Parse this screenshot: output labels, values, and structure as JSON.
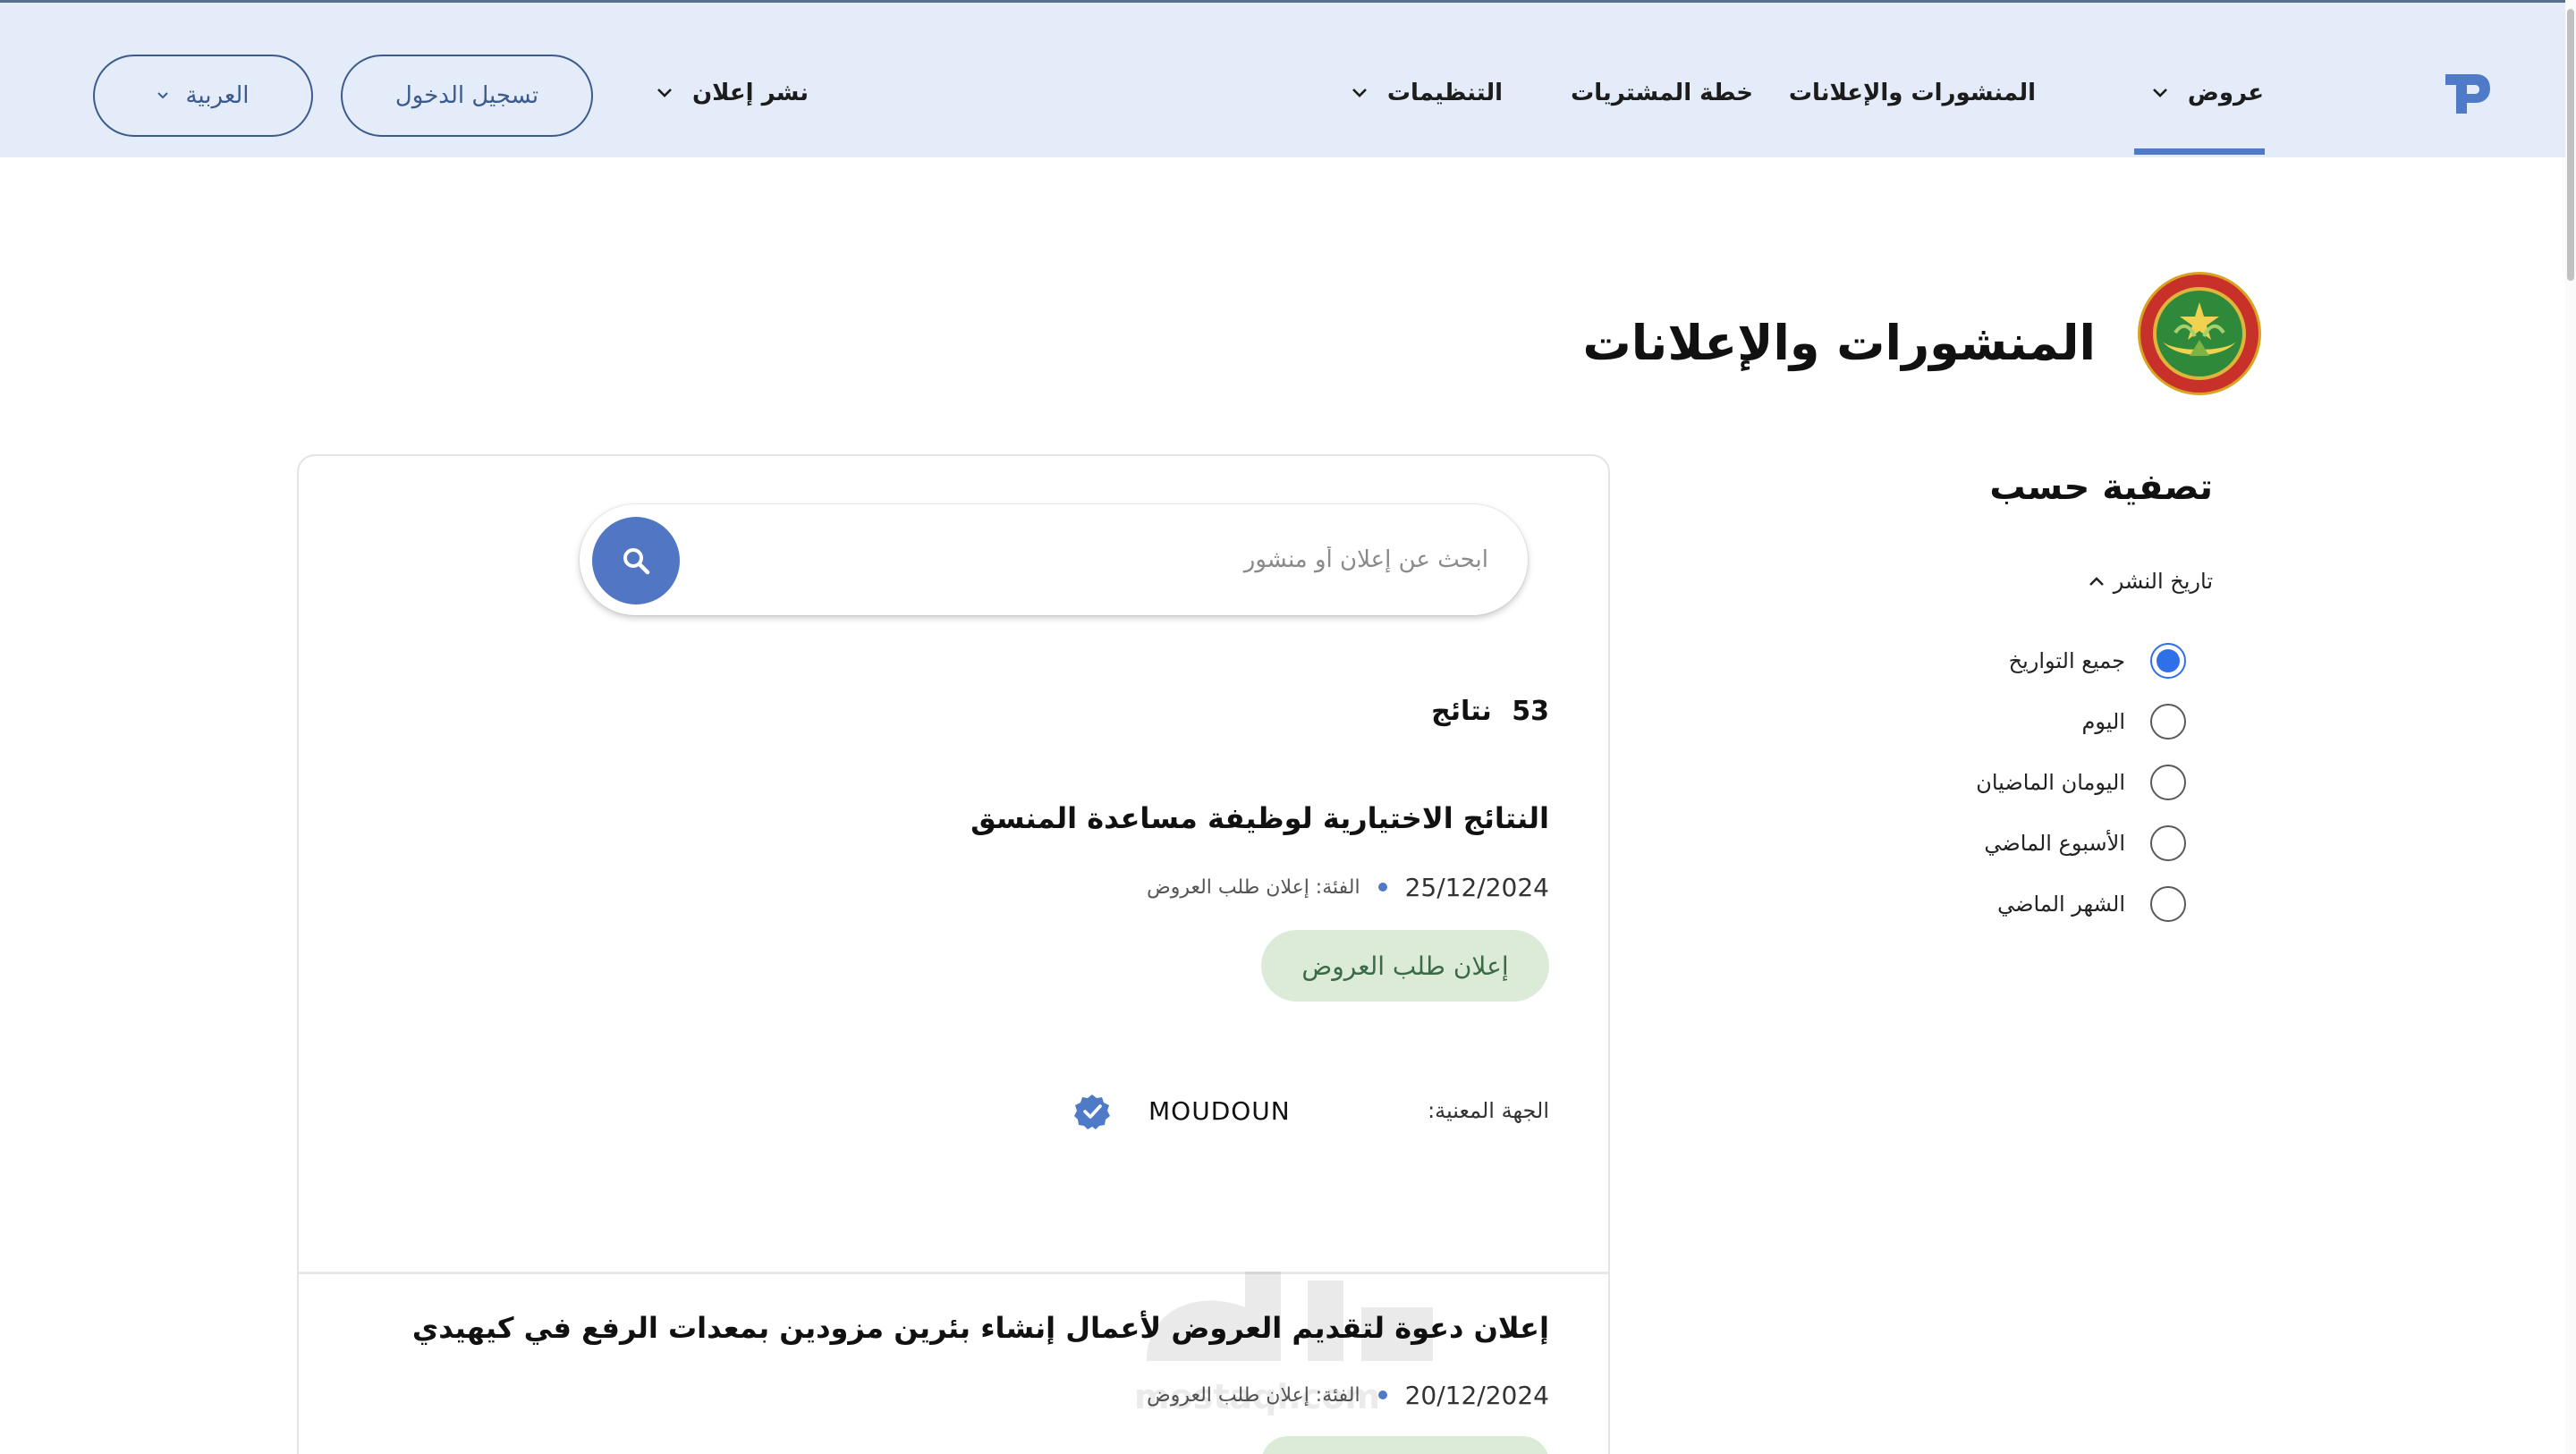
{
  "header": {
    "nav": {
      "offers": "عروض",
      "publications": "المنشورات والإعلانات",
      "procurement_plan": "خطة المشتريات",
      "regulations": "التنظيمات",
      "post_ad": "نشر إعلان"
    },
    "login_label": "تسجيل الدخول",
    "language_label": "العربية",
    "active_nav": "offers",
    "accent_color": "#4f7ac7",
    "header_bg": "#e3ecf8"
  },
  "page": {
    "title": "المنشورات والإعلانات"
  },
  "filters": {
    "title": "تصفية حسب",
    "group_label": "تاريخ النشر",
    "options": [
      {
        "label": "جميع التواريخ",
        "checked": true
      },
      {
        "label": "اليوم",
        "checked": false
      },
      {
        "label": "اليومان الماضيان",
        "checked": false
      },
      {
        "label": "الأسبوع الماضي",
        "checked": false
      },
      {
        "label": "الشهر الماضي",
        "checked": false
      }
    ]
  },
  "search": {
    "placeholder": "ابحث عن إعلان أو منشور",
    "value": ""
  },
  "results": {
    "count": "53",
    "count_label": "نتائج",
    "items": [
      {
        "title": "النتائج الاختيارية لوظيفة مساعدة المنسق",
        "date": "25/12/2024",
        "category": "الفئة: إعلان طلب العروض",
        "tag": "إعلان طلب العروض",
        "entity_label": "الجهة المعنية:",
        "entity_name": "MOUDOUN"
      },
      {
        "title": "إعلان دعوة لتقديم العروض لأعمال إنشاء بئرين مزودين بمعدات الرفع في كيهيدي",
        "date": "20/12/2024",
        "category": "الفئة: إعلان طلب العروض"
      }
    ]
  },
  "watermark": {
    "text": "mostaql.com"
  },
  "colors": {
    "search_button": "#5177c4",
    "radio_checked": "#2f6fe8",
    "tag_bg": "#dcebd8",
    "tag_text": "#3a6a46"
  }
}
